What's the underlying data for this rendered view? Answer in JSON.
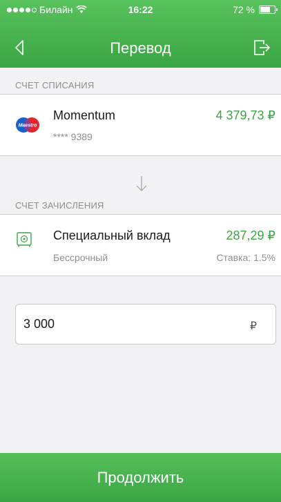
{
  "status_bar": {
    "carrier": "Билайн",
    "time": "16:22",
    "battery": "72 %",
    "battery_level": 0.72
  },
  "nav": {
    "title": "Перевод",
    "back_icon": "back-chevron-icon",
    "exit_icon": "exit-icon"
  },
  "debit": {
    "section_label": "СЧЕТ СПИСАНИЯ",
    "logo": "maestro-logo",
    "logo_text": "Maestro",
    "name": "Momentum",
    "number": "**** 9389",
    "amount": "4 379,73 ₽"
  },
  "credit": {
    "section_label": "СЧЕТ ЗАЧИСЛЕНИЯ",
    "icon": "vault-icon",
    "name": "Специальный вклад",
    "term": "Бессрочный",
    "amount": "287,29 ₽",
    "rate": "Ставка: 1.5%"
  },
  "transfer": {
    "amount_value": "3 000",
    "currency": "₽"
  },
  "footer": {
    "continue_label": "Продолжить"
  },
  "colors": {
    "brand_green": "#3aa544",
    "muted_text": "#8e8e93"
  }
}
